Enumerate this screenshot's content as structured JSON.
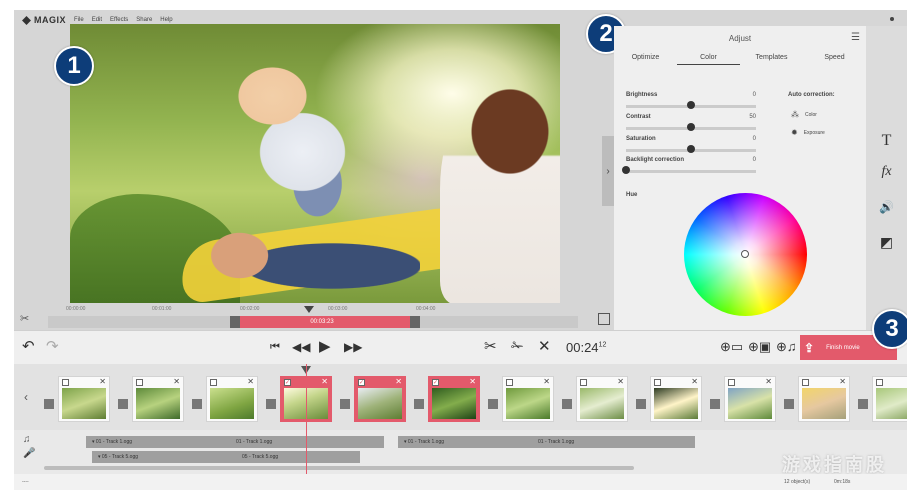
{
  "app": {
    "logo": "MAGIX"
  },
  "menu": [
    "File",
    "Edit",
    "Effects",
    "Share",
    "Help"
  ],
  "callouts": [
    "1",
    "2",
    "3"
  ],
  "preview": {
    "ruler": [
      "00:00:00",
      "00:01:00",
      "00:02:00",
      "00:03:00",
      "00:04:00"
    ],
    "selection_time": "00:03:23"
  },
  "adjust": {
    "title": "Adjust",
    "tabs": [
      "Optimize",
      "Color",
      "Templates",
      "Speed"
    ],
    "active_tab": "Color",
    "sliders": [
      {
        "label": "Brightness",
        "value": "0",
        "level": 0.5
      },
      {
        "label": "Contrast",
        "value": "50",
        "level": 0.5
      },
      {
        "label": "Saturation",
        "value": "0",
        "level": 0.5
      },
      {
        "label": "Backlight correction",
        "value": "0",
        "level": 0.0
      }
    ],
    "auto_correction": {
      "title": "Auto correction:",
      "items": [
        "Color",
        "Exposure"
      ]
    },
    "hue_label": "Hue"
  },
  "tools": [
    {
      "name": "text-icon",
      "glyph": "T"
    },
    {
      "name": "effects-icon",
      "glyph": "fx"
    },
    {
      "name": "audio-icon",
      "glyph": "🔊"
    },
    {
      "name": "contrast-icon",
      "glyph": "◩"
    }
  ],
  "transport": {
    "time_main": "00:24",
    "time_frames": "12",
    "finish_label": "Finish movie"
  },
  "storyboard": {
    "clips": [
      {
        "selected": false
      },
      {
        "selected": false
      },
      {
        "selected": false
      },
      {
        "selected": true
      },
      {
        "selected": true
      },
      {
        "selected": true
      },
      {
        "selected": false
      },
      {
        "selected": false
      },
      {
        "selected": false
      },
      {
        "selected": false
      },
      {
        "selected": false
      },
      {
        "selected": false
      }
    ]
  },
  "audio": {
    "tracks": [
      {
        "a": "▾ 01 - Track 1.ogg",
        "b": "01 - Track 1.ogg"
      },
      {
        "a": "▾ 01 - Track 1.ogg",
        "b": "01 - Track 1.ogg"
      },
      {
        "a": "▾ 05 - Track 5.ogg",
        "b": "05 - Track 5.ogg"
      }
    ]
  },
  "status": {
    "left": "----",
    "objects": "12 object(s)",
    "duration": "0m:18s"
  },
  "watermark": "游戏指南股份",
  "colors": {
    "accent": "#e35a6b",
    "badge": "#0d3d79"
  }
}
